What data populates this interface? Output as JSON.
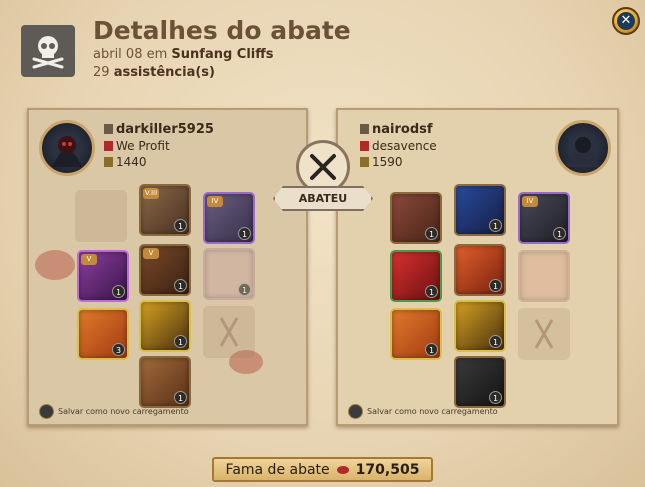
{
  "header": {
    "title": "Detalhes do abate",
    "date": "abril 08",
    "date_connector": "em",
    "location": "Sunfang Cliffs",
    "assists_count": "29",
    "assists_label": "assistência(s)"
  },
  "killer": {
    "name": "darkiller5925",
    "guild": "We Profit",
    "ip": "1440",
    "save_label": "Salvar como novo carregamento"
  },
  "victim": {
    "name": "nairodsf",
    "guild": "desavence",
    "ip": "1590",
    "save_label": "Salvar como novo carregamento"
  },
  "center": {
    "label": "ABATEU"
  },
  "footer": {
    "label": "Fama de abate",
    "value": "170,505"
  },
  "colors": {
    "accent": "#6b5138",
    "gold": "#d9b36b",
    "close": "#1e3a5a"
  }
}
